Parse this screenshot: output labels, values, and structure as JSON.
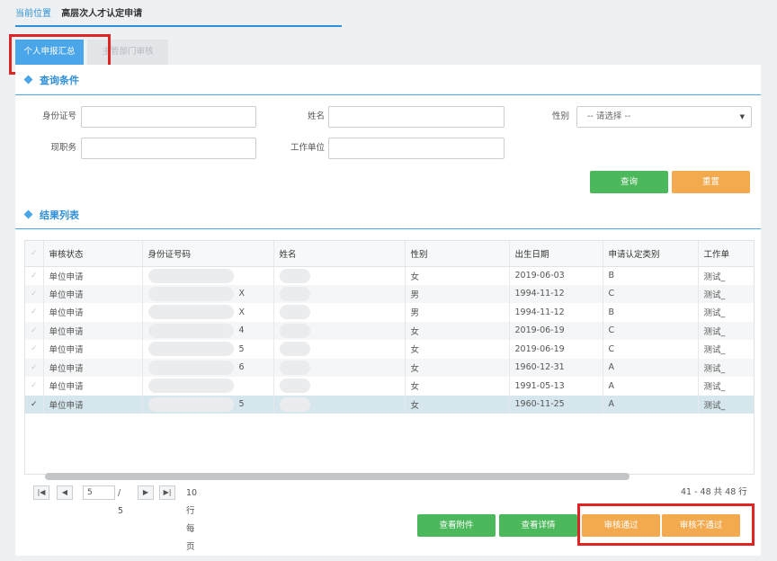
{
  "breadcrumb": {
    "location_label": "当前位置",
    "current": "高层次人才认定申请"
  },
  "tabs": [
    {
      "label": "个人申报汇总",
      "active": true
    },
    {
      "label": "主管部门审核",
      "active": false
    }
  ],
  "query": {
    "title": "查询条件",
    "fields": {
      "id_number": {
        "label": "身份证号",
        "value": ""
      },
      "name": {
        "label": "姓名",
        "value": ""
      },
      "gender": {
        "label": "性别",
        "selected": "-- 请选择 --"
      },
      "position": {
        "label": "现职务",
        "value": ""
      },
      "employer": {
        "label": "工作单位",
        "value": ""
      }
    },
    "search_label": "查询",
    "reset_label": "重置"
  },
  "results": {
    "title": "结果列表",
    "columns": [
      "审核状态",
      "身份证号码",
      "姓名",
      "性别",
      "出生日期",
      "申请认定类别",
      "工作单"
    ],
    "rows": [
      {
        "status": "单位申请",
        "id_tail": "",
        "gender": "女",
        "birth": "2019-06-03",
        "category": "B",
        "employer": "测试_",
        "selected": false
      },
      {
        "status": "单位申请",
        "id_tail": "X",
        "gender": "男",
        "birth": "1994-11-12",
        "category": "C",
        "employer": "测试_",
        "selected": false
      },
      {
        "status": "单位申请",
        "id_tail": "X",
        "gender": "男",
        "birth": "1994-11-12",
        "category": "B",
        "employer": "测试_",
        "selected": false
      },
      {
        "status": "单位申请",
        "id_tail": "4",
        "gender": "女",
        "birth": "2019-06-19",
        "category": "C",
        "employer": "测试_",
        "selected": false
      },
      {
        "status": "单位申请",
        "id_tail": "5",
        "gender": "女",
        "birth": "2019-06-19",
        "category": "C",
        "employer": "测试_",
        "selected": false
      },
      {
        "status": "单位申请",
        "id_tail": "6",
        "gender": "女",
        "birth": "1960-12-31",
        "category": "A",
        "employer": "测试_",
        "selected": false
      },
      {
        "status": "单位申请",
        "id_tail": "",
        "gender": "女",
        "birth": "1991-05-13",
        "category": "A",
        "employer": "测试_",
        "selected": false
      },
      {
        "status": "单位申请",
        "id_tail": "5",
        "gender": "女",
        "birth": "1960-11-25",
        "category": "A",
        "employer": "测试_",
        "selected": true
      }
    ]
  },
  "pagination": {
    "current_page": "5",
    "total_pages_text": "/ 5",
    "per_page_text": "10 行每页",
    "range_text": "41 - 48 共 48 行"
  },
  "actions": {
    "view_attachment": "查看附件",
    "view_detail": "查看详情",
    "approve": "审核通过",
    "reject": "审核不通过"
  },
  "colors": {
    "accent": "#2f8fd8",
    "green": "#4cb85c",
    "orange": "#f3aa4e",
    "highlight": "#e02424"
  }
}
